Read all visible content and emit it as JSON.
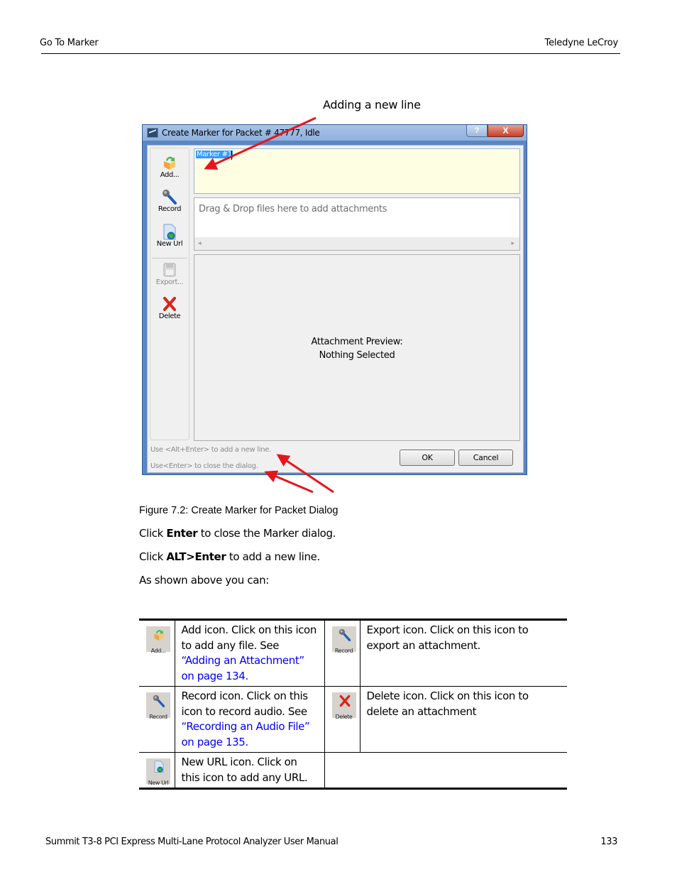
{
  "header": {
    "section": "Go To Marker",
    "company": "Teledyne LeCroy"
  },
  "figure": {
    "callout": "Adding a new line",
    "caption": "Figure 7.2:  Create Marker for Packet Dialog",
    "dialog": {
      "title": "Create Marker for Packet # 47777, Idle",
      "help_glyph": "?",
      "close_glyph": "X",
      "toolbar": [
        {
          "label": "Add...",
          "icon": "folder-add-icon",
          "enabled": true
        },
        {
          "label": "Record",
          "icon": "microphone-icon",
          "enabled": true
        },
        {
          "label": "New Url",
          "icon": "web-page-icon",
          "enabled": true
        },
        {
          "label": "Export...",
          "icon": "floppy-disk-icon",
          "enabled": false
        },
        {
          "label": "Delete",
          "icon": "delete-x-icon",
          "enabled": true
        }
      ],
      "marker_text": "Marker #1",
      "drop_placeholder": "Drag & Drop files here to add attachments",
      "scroll_left": "◂",
      "scroll_right": "▸",
      "preview_line1": "Attachment Preview:",
      "preview_line2": "Nothing Selected",
      "hint_newline": "Use <Alt+Enter> to add a new line.",
      "hint_close": "Use<Enter> to close the dialog.",
      "ok_label": "OK",
      "cancel_label": "Cancel"
    }
  },
  "body": {
    "p1_prefix": "Click ",
    "p1_bold": "Enter",
    "p1_suffix": " to close the Marker dialog.",
    "p2_prefix": "Click ",
    "p2_bold": "ALT>Enter",
    "p2_suffix": " to add a new line.",
    "p3": "As shown above you can:"
  },
  "table": {
    "rows": [
      {
        "left_icon_label": "Add...",
        "left_text": "Add icon. Click on this icon to add any file. See ",
        "left_link": "“Adding an Attachment” on page 134.",
        "right_icon_label": "Record",
        "right_text": "Export icon. Click on this icon to export an attachment."
      },
      {
        "left_icon_label": "Record",
        "left_text": "Record icon. Click on this icon to record audio. See ",
        "left_link": "“Recording an Audio File” on page 135.",
        "right_icon_label": "Delete",
        "right_text": "Delete icon. Click on this icon to delete an attachment"
      },
      {
        "left_icon_label": "New Url",
        "left_text": "New URL icon. Click on this icon to add any URL."
      }
    ]
  },
  "footer": {
    "manual_title": "Summit T3-8 PCI Express Multi-Lane Protocol Analyzer User Manual",
    "page_number": "133"
  },
  "colors": {
    "link": "#0000ee",
    "arrow": "#e8141c",
    "selection": "#3399ff",
    "marker_bg": "#fefee3"
  }
}
